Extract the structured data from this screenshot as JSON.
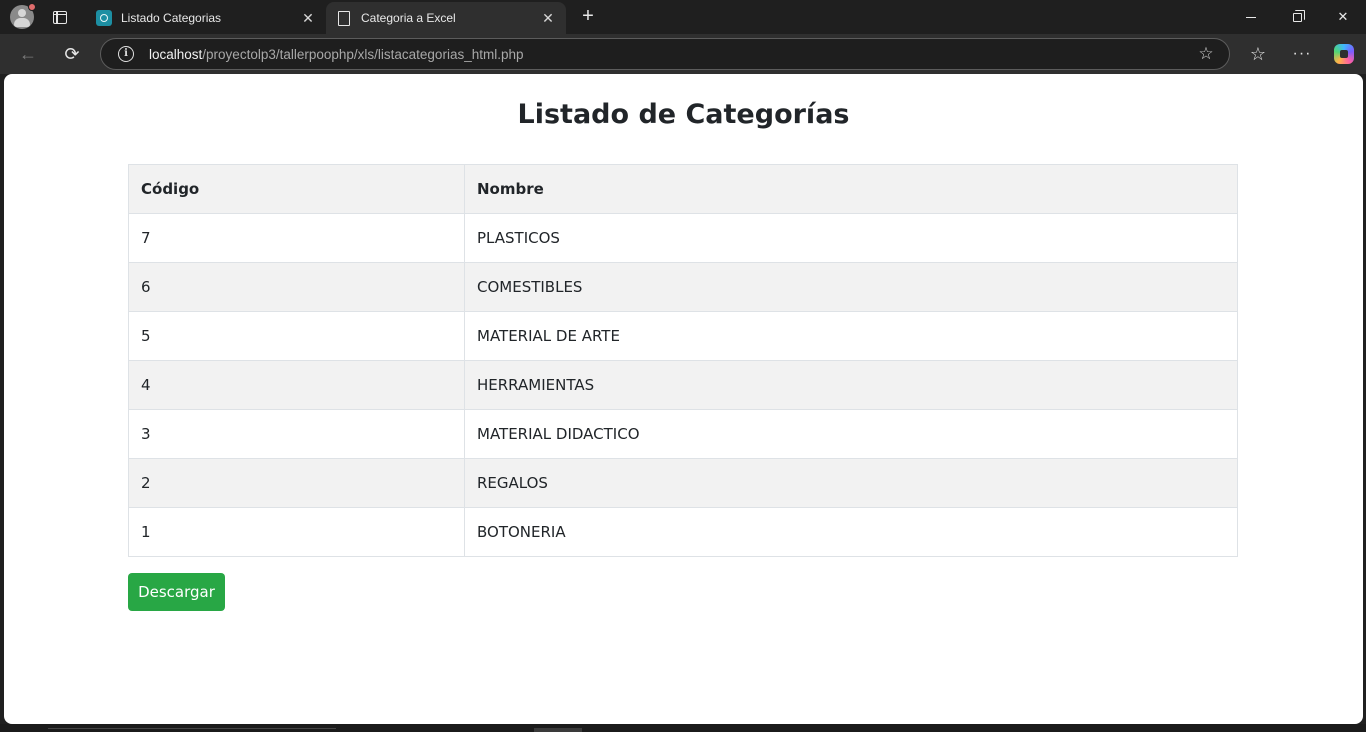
{
  "browser": {
    "tabs": [
      {
        "title": "Listado Categorias",
        "active": false,
        "favicon": "site-icon"
      },
      {
        "title": "Categoria a Excel",
        "active": true,
        "favicon": "document-icon"
      }
    ],
    "url": {
      "host": "localhost",
      "path": "/proyectolp3/tallerpoophp/xls/listacategorias_html.php"
    },
    "accent_color": "#28a745"
  },
  "page": {
    "title": "Listado de Categorías",
    "table": {
      "headers": [
        "Código",
        "Nombre"
      ],
      "rows": [
        {
          "codigo": "7",
          "nombre": "PLASTICOS"
        },
        {
          "codigo": "6",
          "nombre": "COMESTIBLES"
        },
        {
          "codigo": "5",
          "nombre": "MATERIAL DE ARTE"
        },
        {
          "codigo": "4",
          "nombre": "HERRAMIENTAS"
        },
        {
          "codigo": "3",
          "nombre": "MATERIAL DIDACTICO"
        },
        {
          "codigo": "2",
          "nombre": "REGALOS"
        },
        {
          "codigo": "1",
          "nombre": "BOTONERIA"
        }
      ]
    },
    "download_label": "Descargar"
  }
}
